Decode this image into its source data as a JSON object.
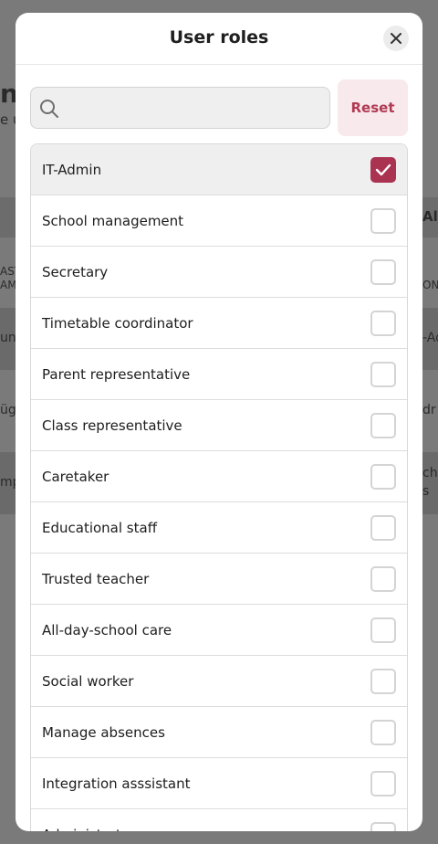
{
  "background": {
    "fragments": [
      "ne",
      "e u",
      "Al",
      "AST",
      "AME",
      "ON",
      "und",
      "-Ad",
      "üg",
      "dr",
      "mp",
      "cho",
      "s"
    ]
  },
  "modal": {
    "title": "User roles",
    "close_icon": "close-icon"
  },
  "search": {
    "placeholder": "",
    "value": "",
    "icon": "search-icon"
  },
  "reset_label": "Reset",
  "roles": [
    {
      "label": "IT-Admin",
      "checked": true
    },
    {
      "label": "School management",
      "checked": false
    },
    {
      "label": "Secretary",
      "checked": false
    },
    {
      "label": "Timetable coordinator",
      "checked": false
    },
    {
      "label": "Parent representative",
      "checked": false
    },
    {
      "label": "Class representative",
      "checked": false
    },
    {
      "label": "Caretaker",
      "checked": false
    },
    {
      "label": "Educational staff",
      "checked": false
    },
    {
      "label": "Trusted teacher",
      "checked": false
    },
    {
      "label": "All-day-school care",
      "checked": false
    },
    {
      "label": "Social worker",
      "checked": false
    },
    {
      "label": "Manage absences",
      "checked": false
    },
    {
      "label": "Integration asssistant",
      "checked": false
    },
    {
      "label": "Administrator",
      "checked": false
    }
  ],
  "colors": {
    "accent": "#ab3352",
    "reset_bg": "#f8e9ec",
    "reset_text": "#b03a52",
    "selected_row": "#efefef",
    "overlay": "#7a7a7a"
  }
}
